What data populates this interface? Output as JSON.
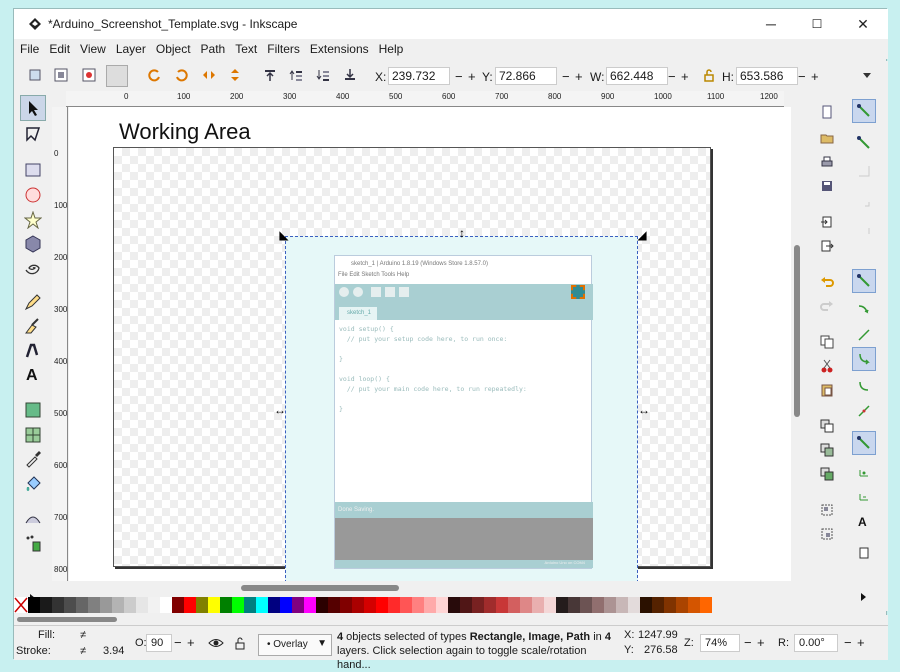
{
  "window": {
    "title": "*Arduino_Screenshot_Template.svg - Inkscape",
    "minimize": "─",
    "maximize": "☐",
    "close": "✕"
  },
  "menu": [
    "File",
    "Edit",
    "View",
    "Layer",
    "Object",
    "Path",
    "Text",
    "Filters",
    "Extensions",
    "Help"
  ],
  "toolbar": {
    "x_label": "X:",
    "x_value": "239.732",
    "y_label": "Y:",
    "y_value": "72.866",
    "w_label": "W:",
    "w_value": "662.448",
    "h_label": "H:",
    "h_value": "653.586",
    "minus": "−",
    "plus": "+"
  },
  "ruler": {
    "h_ticks": [
      "0",
      "100",
      "200",
      "300",
      "400",
      "500",
      "600",
      "700",
      "800",
      "900",
      "1000",
      "1100",
      "1200"
    ],
    "v_ticks": [
      "0",
      "100",
      "200",
      "300",
      "400",
      "500",
      "600",
      "700",
      "800"
    ]
  },
  "canvas": {
    "working_area_label": "Working Area",
    "arduino": {
      "title": "sketch_1 | Arduino 1.8.19 (Windows Store 1.8.57.0)",
      "menu": "File  Edit  Sketch  Tools  Help",
      "tab": "sketch_1",
      "code": "void setup() {\n  // put your setup code here, to run once:\n\n}\n\nvoid loop() {\n  // put your main code here, to run repeatedly:\n\n}",
      "status": "Done Saving.",
      "footer": "Arduino Uno on COM4"
    }
  },
  "status": {
    "fill_label": "Fill:",
    "fill_value": "≠",
    "stroke_label": "Stroke:",
    "stroke_value": "≠",
    "stroke_width": "3.94",
    "opacity_label": "O:",
    "opacity_value": "90",
    "overlay": "Overlay",
    "message_count": "4",
    "message_part1": " objects selected of types ",
    "message_types": "Rectangle, Image, Path",
    "message_part2": " in ",
    "message_layers": "4",
    "message_part3": " layers. Click selection again to toggle scale/rotation hand...",
    "cursor_x_label": "X:",
    "cursor_x": "1247.99",
    "cursor_y_label": "Y:",
    "cursor_y": "276.58",
    "zoom_label": "Z:",
    "zoom": "74%",
    "rotation_label": "R:",
    "rotation": "0.00°"
  },
  "palette_colors": [
    "#000000",
    "#1a1a1a",
    "#333333",
    "#4d4d4d",
    "#666666",
    "#808080",
    "#999999",
    "#b3b3b3",
    "#cccccc",
    "#e6e6e6",
    "#f2f2f2",
    "#ffffff",
    "#800000",
    "#ff0000",
    "#808000",
    "#ffff00",
    "#008000",
    "#00ff00",
    "#008080",
    "#00ffff",
    "#000080",
    "#0000ff",
    "#800080",
    "#ff00ff",
    "#2b0000",
    "#550000",
    "#800000",
    "#aa0000",
    "#d40000",
    "#ff0000",
    "#ff2a2a",
    "#ff5555",
    "#ff8080",
    "#ffaaaa",
    "#ffd5d5",
    "#280b0b",
    "#501616",
    "#782121",
    "#a02c2c",
    "#c83737",
    "#d35f5f",
    "#de8787",
    "#e9afaf",
    "#f4d7d7",
    "#241c1c",
    "#483737",
    "#6c5353",
    "#916f6f",
    "#ac9393",
    "#c8b7b7",
    "#e3dbdb",
    "#2b1100",
    "#552200",
    "#803300",
    "#aa4400",
    "#d45500",
    "#ff6600"
  ]
}
